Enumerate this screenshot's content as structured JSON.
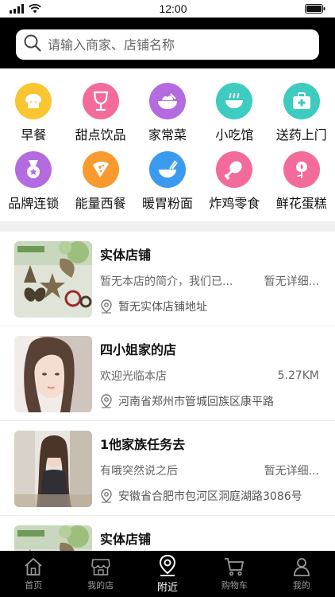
{
  "status_bar": {
    "time": "12:00"
  },
  "search": {
    "placeholder": "请输入商家、店铺名称"
  },
  "categories": [
    {
      "label": "早餐",
      "icon": "bread-icon",
      "color": "#F9C531"
    },
    {
      "label": "甜点饮品",
      "icon": "drink-glass-icon",
      "color": "#F36B9B"
    },
    {
      "label": "家常菜",
      "icon": "salad-bowl-icon",
      "color": "#B46BE0"
    },
    {
      "label": "小吃馆",
      "icon": "hot-bowl-icon",
      "color": "#3ECBC0"
    },
    {
      "label": "送药上门",
      "icon": "medical-kit-icon",
      "color": "#3ECBC0"
    },
    {
      "label": "品牌连锁",
      "icon": "medal-icon",
      "color": "#B46BE0"
    },
    {
      "label": "能量西餐",
      "icon": "pizza-icon",
      "color": "#F89A2E"
    },
    {
      "label": "暖胃粉面",
      "icon": "noodle-bowl-icon",
      "color": "#3A9AF0"
    },
    {
      "label": "炸鸡零食",
      "icon": "chicken-leg-icon",
      "color": "#F36B9B"
    },
    {
      "label": "鲜花蛋糕",
      "icon": "flower-icon",
      "color": "#F36B9B"
    }
  ],
  "stores": [
    {
      "name": "实体店铺",
      "desc": "暂无本店的简介，我们已...",
      "distance": "暂无详细...",
      "address": "暂无实体店铺地址",
      "image": "decor-photo"
    },
    {
      "name": "四小姐家的店",
      "desc": "欢迎光临本店",
      "distance": "5.27KM",
      "address": "河南省郑州市管城回族区康平路",
      "image": "woman-portrait-photo"
    },
    {
      "name": "1他家族任务去",
      "desc": "有哦突然说之后",
      "distance": "暂无详细...",
      "address": "安徽省合肥市包河区洞庭湖路3086号",
      "image": "girl-photo"
    },
    {
      "name": "实体店铺",
      "desc": "",
      "distance": "",
      "address": "",
      "image": "decor-photo"
    }
  ],
  "tabs": [
    {
      "label": "首页",
      "icon": "home-icon",
      "active": false
    },
    {
      "label": "我的店",
      "icon": "store-icon",
      "active": false
    },
    {
      "label": "附近",
      "icon": "location-pin-icon",
      "active": true
    },
    {
      "label": "购物车",
      "icon": "cart-icon",
      "active": false
    },
    {
      "label": "我的",
      "icon": "user-icon",
      "active": false
    }
  ]
}
